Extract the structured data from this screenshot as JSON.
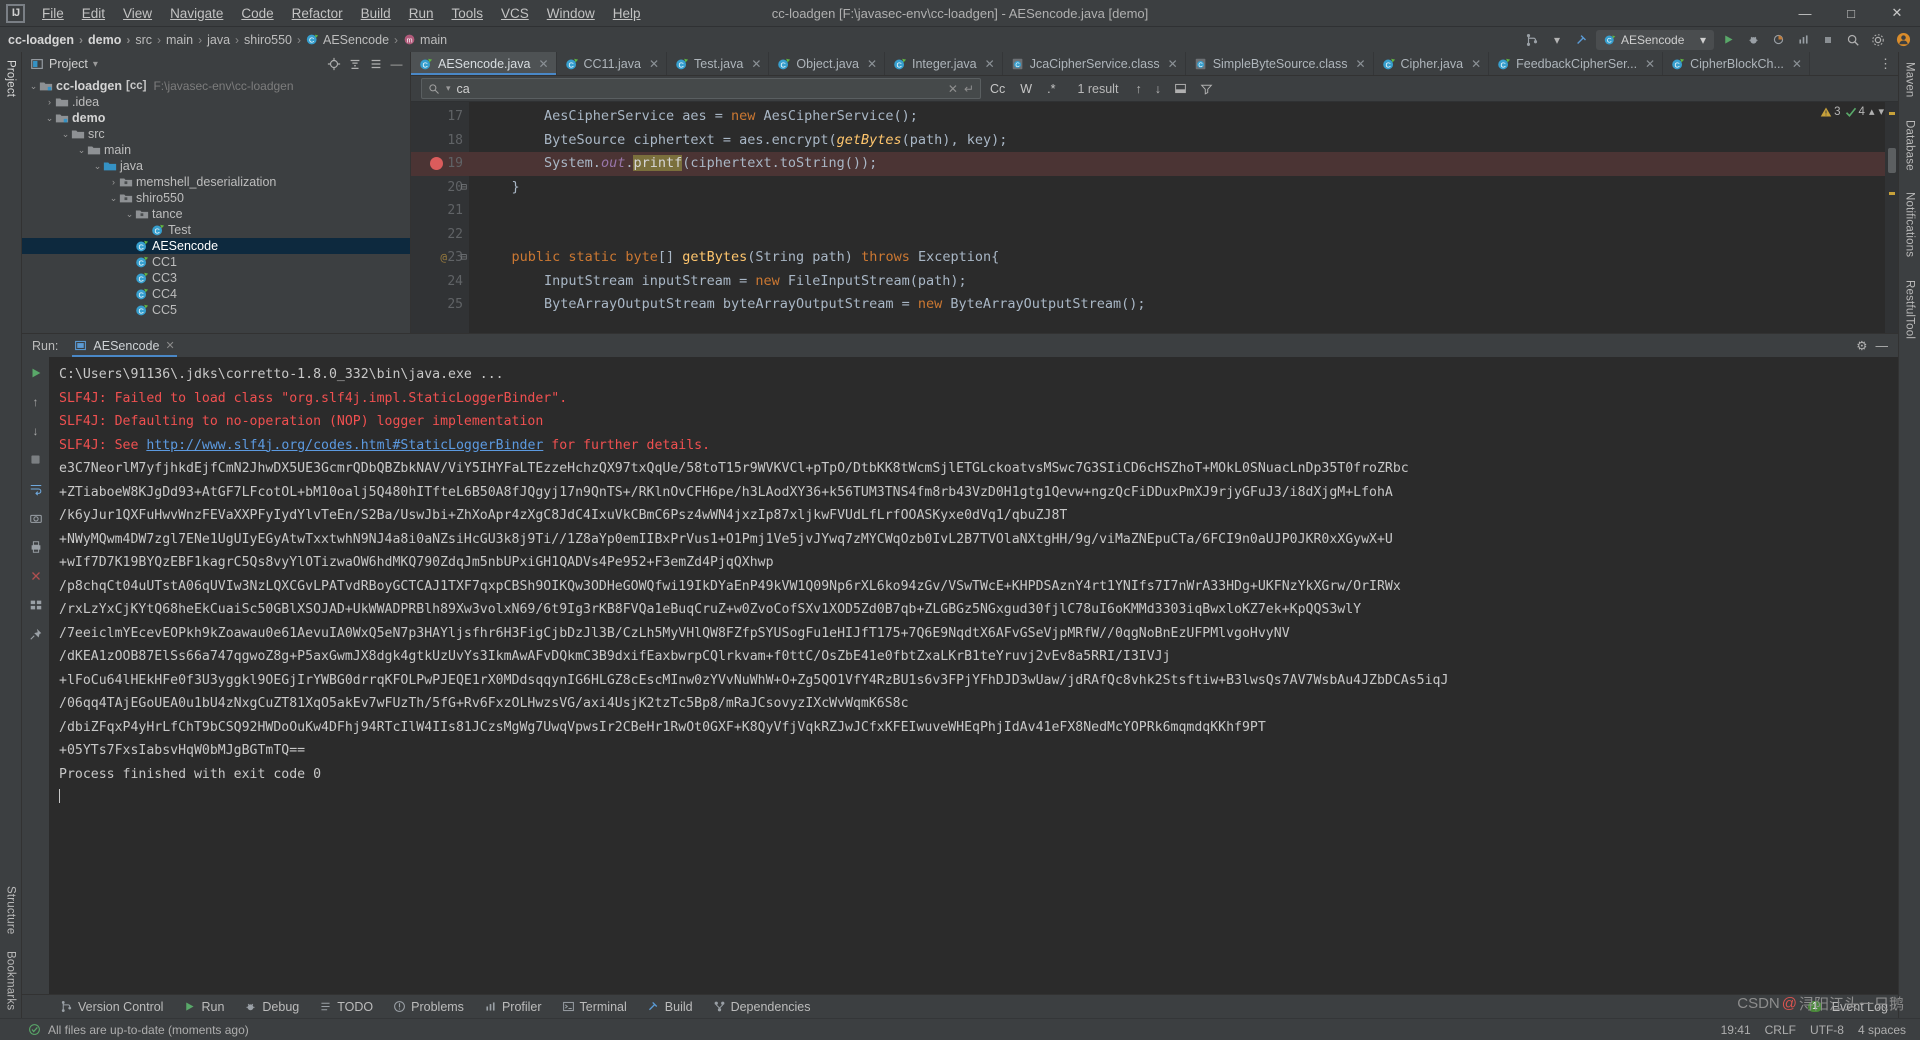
{
  "titlebar": {
    "logo": "IJ",
    "menus": [
      "File",
      "Edit",
      "View",
      "Navigate",
      "Code",
      "Refactor",
      "Build",
      "Run",
      "Tools",
      "VCS",
      "Window",
      "Help"
    ],
    "window_title": "cc-loadgen [F:\\javasec-env\\cc-loadgen] - AESencode.java [demo]",
    "minimize": "—",
    "maximize": "□",
    "close": "✕"
  },
  "breadcrumb": {
    "items": [
      "cc-loadgen",
      "demo",
      "src",
      "main",
      "java",
      "shiro550",
      "AESencode",
      "main"
    ],
    "separator": "›",
    "run_config": "AESencode",
    "run_button": "▶",
    "debug_button": "🐞",
    "search_button": "🔍"
  },
  "left_rail": {
    "top": "Project",
    "bottom_items": [
      "Structure",
      "Bookmarks"
    ]
  },
  "right_rail": {
    "items": [
      "Maven",
      "Database",
      "Notifications",
      "RestfulTool"
    ]
  },
  "project_panel": {
    "title": "Project",
    "tree": [
      {
        "depth": 0,
        "arrow": "∨",
        "label": "cc-loadgen",
        "bold": true,
        "badge": "[cc]",
        "path": "F:\\javasec-env\\cc-loadgen",
        "icon": "module-icon",
        "selected": false
      },
      {
        "depth": 1,
        "arrow": "›",
        "label": ".idea",
        "bold": false,
        "badge": "",
        "path": "",
        "icon": "folder-icon",
        "selected": false
      },
      {
        "depth": 1,
        "arrow": "∨",
        "label": "demo",
        "bold": true,
        "badge": "",
        "path": "",
        "icon": "module-icon",
        "selected": false
      },
      {
        "depth": 2,
        "arrow": "∨",
        "label": "src",
        "bold": false,
        "badge": "",
        "path": "",
        "icon": "folder-icon",
        "selected": false
      },
      {
        "depth": 3,
        "arrow": "∨",
        "label": "main",
        "bold": false,
        "badge": "",
        "path": "",
        "icon": "folder-icon",
        "selected": false
      },
      {
        "depth": 4,
        "arrow": "∨",
        "label": "java",
        "bold": false,
        "badge": "",
        "path": "",
        "icon": "source-folder-icon",
        "selected": false
      },
      {
        "depth": 5,
        "arrow": "›",
        "label": "memshell_deserialization",
        "bold": false,
        "badge": "",
        "path": "",
        "icon": "package-icon",
        "selected": false
      },
      {
        "depth": 5,
        "arrow": "∨",
        "label": "shiro550",
        "bold": false,
        "badge": "",
        "path": "",
        "icon": "package-icon",
        "selected": false
      },
      {
        "depth": 6,
        "arrow": "∨",
        "label": "tance",
        "bold": false,
        "badge": "",
        "path": "",
        "icon": "package-icon",
        "selected": false
      },
      {
        "depth": 7,
        "arrow": "",
        "label": "Test",
        "bold": false,
        "badge": "",
        "path": "",
        "icon": "java-class-icon",
        "selected": false
      },
      {
        "depth": 6,
        "arrow": "",
        "label": "AESencode",
        "bold": false,
        "badge": "",
        "path": "",
        "icon": "java-class-icon",
        "selected": true
      },
      {
        "depth": 6,
        "arrow": "",
        "label": "CC1",
        "bold": false,
        "badge": "",
        "path": "",
        "icon": "java-class-icon",
        "selected": false
      },
      {
        "depth": 6,
        "arrow": "",
        "label": "CC3",
        "bold": false,
        "badge": "",
        "path": "",
        "icon": "java-class-icon",
        "selected": false
      },
      {
        "depth": 6,
        "arrow": "",
        "label": "CC4",
        "bold": false,
        "badge": "",
        "path": "",
        "icon": "java-class-icon",
        "selected": false
      },
      {
        "depth": 6,
        "arrow": "",
        "label": "CC5",
        "bold": false,
        "badge": "",
        "path": "",
        "icon": "java-class-icon",
        "selected": false
      }
    ]
  },
  "editor": {
    "tabs": [
      {
        "label": "AESencode.java",
        "icon": "java-runnable-icon",
        "active": true
      },
      {
        "label": "CC11.java",
        "icon": "java-runnable-icon",
        "active": false
      },
      {
        "label": "Test.java",
        "icon": "java-runnable-icon",
        "active": false
      },
      {
        "label": "Object.java",
        "icon": "java-class-icon",
        "active": false
      },
      {
        "label": "Integer.java",
        "icon": "java-class-icon",
        "active": false
      },
      {
        "label": "JcaCipherService.class",
        "icon": "class-file-icon",
        "active": false
      },
      {
        "label": "SimpleByteSource.class",
        "icon": "class-file-icon",
        "active": false
      },
      {
        "label": "Cipher.java",
        "icon": "java-class-icon",
        "active": false
      },
      {
        "label": "FeedbackCipherSer...",
        "icon": "java-class-icon",
        "active": false
      },
      {
        "label": "CipherBlockCh...",
        "icon": "java-class-icon",
        "active": false
      }
    ],
    "find": {
      "value": "ca",
      "placeholder": "Search",
      "result_text": "1 result",
      "case_toggle": "Cc",
      "word_toggle": "W",
      "regex_toggle": ".*",
      "prev": "↑",
      "next": "↓"
    },
    "inspection": {
      "warnings": "3",
      "checks": "4"
    },
    "lines": [
      {
        "num": "17",
        "indent": 8,
        "breakpoint": false,
        "highlight": false,
        "annot": "",
        "fold": false,
        "tokens": [
          {
            "t": "AesCipherService aes = ",
            "c": ""
          },
          {
            "t": "new",
            "c": "k"
          },
          {
            "t": " AesCipherService();",
            "c": ""
          }
        ]
      },
      {
        "num": "18",
        "indent": 8,
        "breakpoint": false,
        "highlight": false,
        "annot": "",
        "fold": false,
        "tokens": [
          {
            "t": "ByteSource ciphertext = aes.encrypt(",
            "c": ""
          },
          {
            "t": "getBytes",
            "c": "fi"
          },
          {
            "t": "(path), key);",
            "c": ""
          }
        ]
      },
      {
        "num": "19",
        "indent": 8,
        "breakpoint": true,
        "highlight": true,
        "annot": "",
        "fold": false,
        "tokens": [
          {
            "t": "System.",
            "c": ""
          },
          {
            "t": "out",
            "c": "p"
          },
          {
            "t": ".",
            "c": ""
          },
          {
            "t": "printf",
            "c": "match"
          },
          {
            "t": "(ciphertext.toString());",
            "c": ""
          }
        ]
      },
      {
        "num": "20",
        "indent": 4,
        "breakpoint": false,
        "highlight": false,
        "annot": "",
        "fold": true,
        "tokens": [
          {
            "t": "}",
            "c": ""
          }
        ]
      },
      {
        "num": "21",
        "indent": 0,
        "breakpoint": false,
        "highlight": false,
        "annot": "",
        "fold": false,
        "tokens": []
      },
      {
        "num": "22",
        "indent": 0,
        "breakpoint": false,
        "highlight": false,
        "annot": "",
        "fold": false,
        "tokens": []
      },
      {
        "num": "23",
        "indent": 4,
        "breakpoint": false,
        "highlight": false,
        "annot": "@",
        "fold": true,
        "tokens": [
          {
            "t": "public static",
            "c": "k"
          },
          {
            "t": " ",
            "c": ""
          },
          {
            "t": "byte",
            "c": "k"
          },
          {
            "t": "[] ",
            "c": ""
          },
          {
            "t": "getBytes",
            "c": "f"
          },
          {
            "t": "(String path) ",
            "c": ""
          },
          {
            "t": "throws",
            "c": "k"
          },
          {
            "t": " Exception{",
            "c": ""
          }
        ]
      },
      {
        "num": "24",
        "indent": 8,
        "breakpoint": false,
        "highlight": false,
        "annot": "",
        "fold": false,
        "tokens": [
          {
            "t": "InputStream inputStream = ",
            "c": ""
          },
          {
            "t": "new",
            "c": "k"
          },
          {
            "t": " FileInputStream(path);",
            "c": ""
          }
        ]
      },
      {
        "num": "25",
        "indent": 8,
        "breakpoint": false,
        "highlight": false,
        "annot": "",
        "fold": false,
        "tokens": [
          {
            "t": "ByteArrayOutputStream byteArrayOutputStream = ",
            "c": ""
          },
          {
            "t": "new",
            "c": "k"
          },
          {
            "t": " ByteArrayOutputStream();",
            "c": ""
          }
        ]
      }
    ]
  },
  "run_panel": {
    "label": "Run:",
    "tab": "AESencode",
    "tab_close": "✕",
    "settings_icon": "⚙",
    "hide_icon": "—",
    "toolbar_icons": [
      "rerun-icon",
      "up-icon",
      "down-icon",
      "stop-icon",
      "pause-icon",
      "wrap-icon",
      "camera-icon",
      "print-icon",
      "clear-icon",
      "grid-icon",
      "pin-icon"
    ],
    "console": [
      {
        "text": "C:\\Users\\91136\\.jdks\\corretto-1.8.0_332\\bin\\java.exe ...",
        "cls": "c-out"
      },
      {
        "text": "SLF4J: Failed to load class \"org.slf4j.impl.StaticLoggerBinder\".",
        "cls": "c-err"
      },
      {
        "text": "SLF4J: Defaulting to no-operation (NOP) logger implementation",
        "cls": "c-err"
      },
      {
        "text": "SLF4J: See http://www.slf4j.org/codes.html#StaticLoggerBinder for further details.",
        "cls": "c-err-link",
        "link": "http://www.slf4j.org/codes.html#StaticLoggerBinder",
        "prefix": "SLF4J: See ",
        "suffix": " for further details."
      },
      {
        "text": "e3C7NeorlM7yfjhkdEjfCmN2JhwDX5UE3GcmrQDbQBZbkNAV/ViY5IHYFaLTEzzeHchzQX97txQqUe/58toT15r9WVKVCl+pTpO/DtbKK8tWcmSjlETGLckoatvsMSwc7G3SIiCD6cHSZhoT+MOkL0SNuacLnDp35T0froZRbc",
        "cls": "c-out"
      },
      {
        "text": "+ZTiaboeW8KJgDd93+AtGF7LFcotOL+bM10oalj5Q480hITfteL6B50A8fJQgyj17n9QnTS+/RKlnOvCFH6pe/h3LAodXY36+k56TUM3TNS4fm8rb43VzD0H1gtg1Qevw+ngzQcFiDDuxPmXJ9rjyGFuJ3/i8dXjgM+LfohA",
        "cls": "c-out"
      },
      {
        "text": "/k6yJur1QXFuHwvWnzFEVaXXPFyIydYlvTeEn/S2Ba/UswJbi+ZhXoApr4zXgC8JdC4IxuVkCBmC6Psz4wWN4jxzIp87xljkwFVUdLfLrfOOASKyxe0dVq1/qbuZJ8T",
        "cls": "c-out"
      },
      {
        "text": "+NWyMQwm4DW7zgl7ENe1UgUIyEGyAtwTxxtwhN9NJ4a8i0aNZsiHcGU3k8j9Ti//1Z8aYp0emIIBxPrVus1+O1Pmj1Ve5jvJYwq7zMYCWqOzb0IvL2B7TVOlaNXtgHH/9g/viMaZNEpuCTa/6FCI9n0aUJP0JKR0xXGywX+U",
        "cls": "c-out"
      },
      {
        "text": "+wIf7D7K19BYQzEBF1kagrC5Qs8vyYlOTizwaOW6hdMKQ790ZdqJm5nbUPxiGH1QADVs4Pe952+F3emZd4PjqQXhwp",
        "cls": "c-out"
      },
      {
        "text": "/p8chqCt04uUTstA06qUVIw3NzLQXCGvLPATvdRBoyGCTCAJ1TXF7qxpCBSh9OIKQw3ODHeGOWQfwi19IkDYaEnP49kVW1Q09Np6rXL6ko94zGv/VSwTWcE+KHPDSAznY4rt1YNIfs7I7nWrA33HDg+UKFNzYkXGrw/OrIRWx",
        "cls": "c-out"
      },
      {
        "text": "/rxLzYxCjKYtQ68heEkCuaiSc50GBlXSOJAD+UkWWADPRBlh89Xw3volxN69/6t9Ig3rKB8FVQa1eBuqCruZ+w0ZvoCofSXv1XOD5Zd0B7qb+ZLGBGz5NGxgud30fjlC78uI6oKMMd3303iqBwxloKZ7ek+KpQQS3wlY",
        "cls": "c-out"
      },
      {
        "text": "/7eeiclmYEcevEOPkh9kZoawau0e61AevuIA0WxQ5eN7p3HAYljsfhr6H3FigCjbDzJl3B/CzLh5MyVHlQW8FZfpSYUSogFu1eHIJfT175+7Q6E9NqdtX6AFvGSeVjpMRfW//0qgNoBnEzUFPMlvgoHvyNV",
        "cls": "c-out"
      },
      {
        "text": "/dKEA1zOOB87ElSs66a747qgwoZ8g+P5axGwmJX8dgk4gtkUzUvYs3IkmAwAFvDQkmC3B9dxifEaxbwrpCQlrkvam+f0ttC/OsZbE41e0fbtZxaLKrB1teYruvj2vEv8a5RRI/I3IVJj",
        "cls": "c-out"
      },
      {
        "text": "+lFoCu64lHEkHFe0f3U3yggkl9OEGjIrYWBG0drrqKFOLPwPJEQE1rX0MDdsqqynIG6HLGZ8cEscMInw0zYVvNuWhW+O+Zg5QO1VfY4RzBU1s6v3FPjYFhDJD3wUaw/jdRAfQc8vhk2Stsftiw+B3lwsQs7AV7WsbAu4JZbDCAs5iqJ",
        "cls": "c-out"
      },
      {
        "text": "/06qq4TAjEGoUEA0u1bU4zNxgCuZT81XqO5akEv7wFUzTh/5fG+Rv6FxzOLHwzsVG/axi4UsjK2tzTc5Bp8/mRaJCsovyzIXcWvWqmK6S8c",
        "cls": "c-out"
      },
      {
        "text": "/dbiZFqxP4yHrLfChT9bCSQ92HWDoOuKw4DFhj94RTcIlW4IIs81JCzsMgWg7UwqVpwsIr2CBeHr1RwOt0GXF+K8QyVfjVqkRZJwJCfxKFEIwuveWHEqPhjIdAv41eFX8NedMcYOPRk6mqmdqKKhf9PT",
        "cls": "c-out"
      },
      {
        "text": "+05YTs7FxsIabsvHqW0bMJgBGTmTQ==",
        "cls": "c-out"
      },
      {
        "text": "Process finished with exit code 0",
        "cls": "c-out"
      }
    ]
  },
  "bottom_bar": {
    "items": [
      {
        "label": "Version Control",
        "icon": "branch-icon"
      },
      {
        "label": "Run",
        "icon": "run-icon"
      },
      {
        "label": "Debug",
        "icon": "debug-icon"
      },
      {
        "label": "TODO",
        "icon": "todo-icon"
      },
      {
        "label": "Problems",
        "icon": "problems-icon"
      },
      {
        "label": "Profiler",
        "icon": "profiler-icon"
      },
      {
        "label": "Terminal",
        "icon": "terminal-icon"
      },
      {
        "label": "Build",
        "icon": "build-icon"
      },
      {
        "label": "Dependencies",
        "icon": "dependencies-icon"
      }
    ],
    "event_log": "Event Log",
    "event_count": "1"
  },
  "statusbar": {
    "message": "All files are up-to-date (moments ago)",
    "caret": "19:41",
    "line_sep": "CRLF",
    "encoding": "UTF-8",
    "indent": "4 spaces"
  },
  "watermark": {
    "prefix": "CSDN",
    "at": "@",
    "author": "浔阳江头一只鹅"
  }
}
